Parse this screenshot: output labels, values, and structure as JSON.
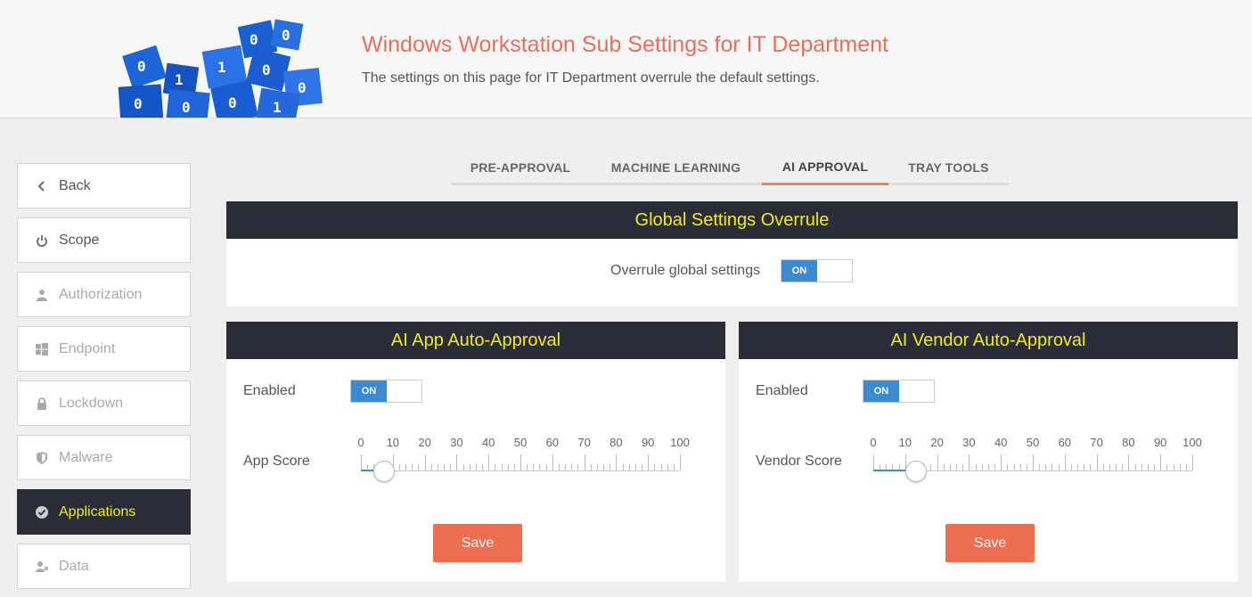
{
  "header": {
    "title": "Windows Workstation Sub Settings for IT Department",
    "subtitle": "The settings on this page for IT Department overrule the default settings."
  },
  "sidebar": {
    "items": [
      {
        "label": "Back",
        "icon": "chevron-left-icon",
        "state": "normal"
      },
      {
        "label": "Scope",
        "icon": "power-icon",
        "state": "normal"
      },
      {
        "label": "Authorization",
        "icon": "user-icon",
        "state": "disabled"
      },
      {
        "label": "Endpoint",
        "icon": "windows-icon",
        "state": "disabled"
      },
      {
        "label": "Lockdown",
        "icon": "lock-icon",
        "state": "disabled"
      },
      {
        "label": "Malware",
        "icon": "shield-icon",
        "state": "disabled"
      },
      {
        "label": "Applications",
        "icon": "check-circle-icon",
        "state": "active"
      },
      {
        "label": "Data",
        "icon": "user-x-icon",
        "state": "disabled"
      }
    ]
  },
  "tabs": [
    {
      "label": "PRE-APPROVAL",
      "active": false
    },
    {
      "label": "MACHINE LEARNING",
      "active": false
    },
    {
      "label": "AI APPROVAL",
      "active": true
    },
    {
      "label": "TRAY TOOLS",
      "active": false
    }
  ],
  "global": {
    "title": "Global Settings Overrule",
    "overrule_label": "Overrule global settings",
    "toggle": "ON"
  },
  "app_panel": {
    "title": "AI App Auto-Approval",
    "enabled_label": "Enabled",
    "toggle": "ON",
    "score_label": "App Score",
    "score_value": 4,
    "scale": [
      "0",
      "10",
      "20",
      "30",
      "40",
      "50",
      "60",
      "70",
      "80",
      "90",
      "100"
    ],
    "save_label": "Save"
  },
  "vendor_panel": {
    "title": "AI Vendor Auto-Approval",
    "enabled_label": "Enabled",
    "toggle": "ON",
    "score_label": "Vendor Score",
    "score_value": 10,
    "scale": [
      "0",
      "10",
      "20",
      "30",
      "40",
      "50",
      "60",
      "70",
      "80",
      "90",
      "100"
    ],
    "save_label": "Save"
  },
  "colors": {
    "accent": "#ee6e54",
    "title": "#e8705a",
    "dark": "#2a2d38",
    "highlight": "#f2ea1e",
    "toggle_on": "#3c8ad2",
    "tab_active": "#e8844e"
  }
}
